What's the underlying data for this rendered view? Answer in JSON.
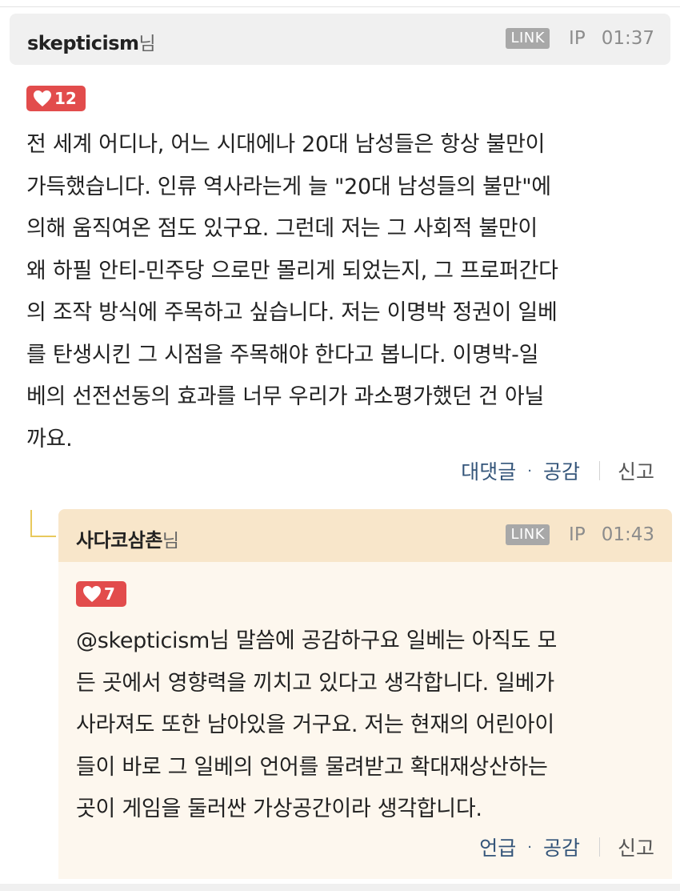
{
  "comment": {
    "author": "skepticism",
    "author_suffix": "님",
    "link_label": "LINK",
    "ip_label": "IP",
    "time": "01:37",
    "likes": "12",
    "body_lines": [
      "전 세계 어디나, 어느 시대에나 20대 남성들은 항상 불만이",
      "가득했습니다. 인류 역사라는게 늘 \"20대 남성들의 불만\"에",
      "의해 움직여온 점도 있구요. 그런데 저는 그 사회적 불만이",
      "왜 하필 안티-민주당 으로만 몰리게 되었는지, 그 프로퍼간다",
      "의 조작 방식에 주목하고 싶습니다. 저는 이명박 정권이 일베",
      "를 탄생시킨 그 시점을 주목해야 한다고 봅니다. 이명박-일",
      "베의 선전선동의 효과를 너무 우리가 과소평가했던 건 아닐",
      "까요."
    ],
    "actions": {
      "reply": "대댓글",
      "dot": "·",
      "like": "공감",
      "report": "신고"
    }
  },
  "reply": {
    "author": "사다코삼촌",
    "author_suffix": "님",
    "link_label": "LINK",
    "ip_label": "IP",
    "time": "01:43",
    "likes": "7",
    "body_lines": [
      "@skepticism님 말씀에 공감하구요 일베는 아직도 모",
      "든 곳에서 영향력을 끼치고 있다고 생각합니다. 일베가",
      "사라져도 또한 남아있을 거구요. 저는 현재의 어린아이",
      "들이 바로 그 일베의 언어를 물려받고 확대재상산하는",
      "곳이 게임을 둘러싼 가상공간이라 생각합니다."
    ],
    "actions": {
      "mention": "언급",
      "dot": "·",
      "like": "공감",
      "report": "신고"
    }
  },
  "colors": {
    "like_badge": "#e24c4c",
    "action_link": "#34557a",
    "reply_header_bg": "#f8e6ca",
    "reply_body_bg": "#fdf7ee",
    "connector": "#e8c95c"
  }
}
